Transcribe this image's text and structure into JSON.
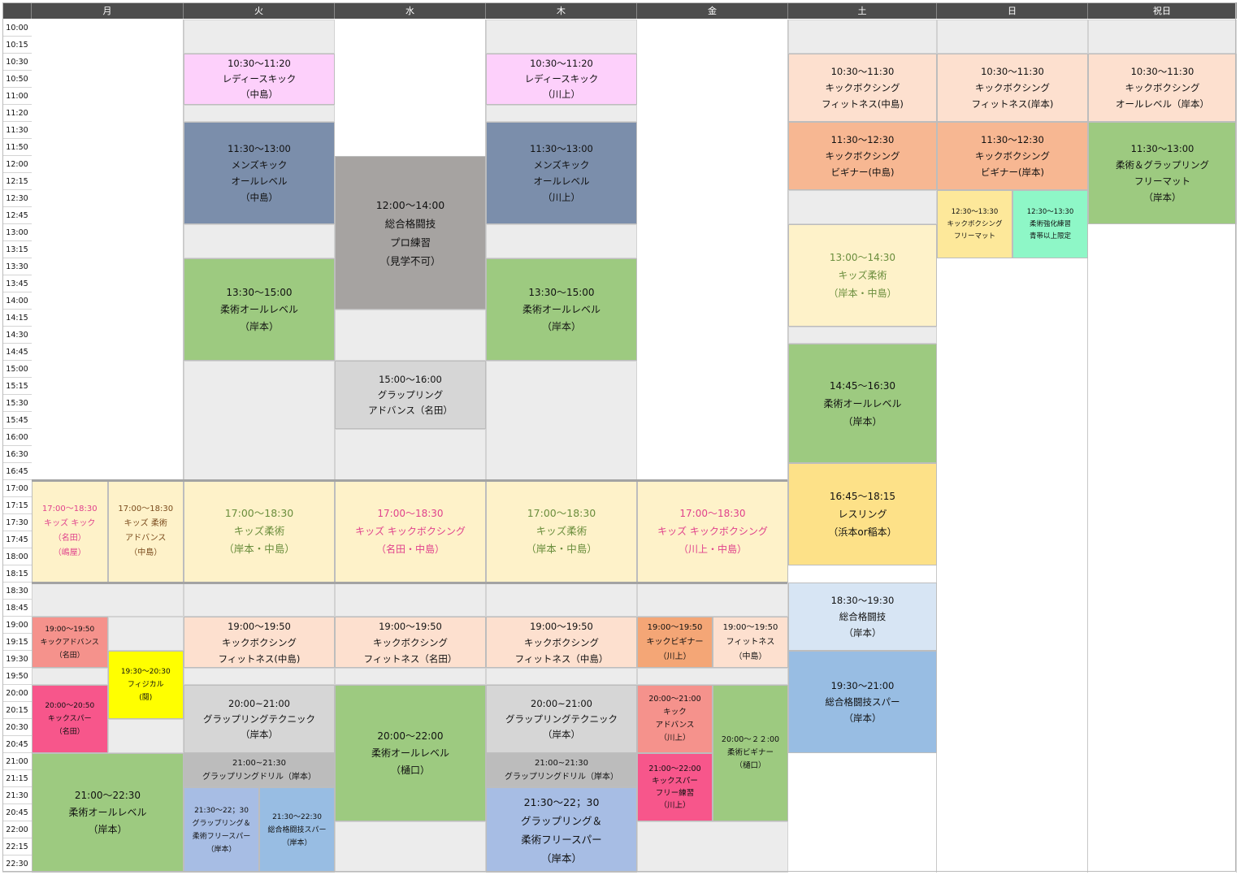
{
  "colors": {
    "gray_blank": "#ececec",
    "pink": "#fdd0fb",
    "slate": "#7b8eab",
    "green": "#9dca80",
    "darkgray": "#a6a3a1",
    "lightgray2": "#d6d6d6",
    "cream": "#fef2c9",
    "peach": "#fde0cf",
    "orange": "#f7b792",
    "yellow_card": "#fde188",
    "pale_blue": "#d7e5f4",
    "blue": "#98bde3",
    "mint": "#8ef7c7",
    "light_yellow": "#fde89a",
    "salmon": "#f5928c",
    "hotpink": "#f7568b",
    "bright_yellow": "#ffff00",
    "gray_mid": "#bcbcbc",
    "periwinkle": "#a7bde4",
    "orange2": "#f4a676"
  },
  "days": [
    "月",
    "火",
    "水",
    "木",
    "金",
    "土",
    "日",
    "祝日"
  ],
  "times": [
    "10:00",
    "10:15",
    "10:30",
    "10:50",
    "11:00",
    "11:20",
    "11:30",
    "11:50",
    "12:00",
    "12:15",
    "12:30",
    "12:45",
    "13:00",
    "13:15",
    "13:30",
    "13:45",
    "14:00",
    "14:15",
    "14:30",
    "14:45",
    "15:00",
    "15:15",
    "15:30",
    "15:45",
    "16:00",
    "16:30",
    "16:45",
    "17:00",
    "17:15",
    "17:30",
    "17:45",
    "18:00",
    "18:15",
    "18:30",
    "18:45",
    "19:00",
    "19:15",
    "19:30",
    "19:50",
    "20:00",
    "20:15",
    "20:30",
    "20:45",
    "21:00",
    "21:15",
    "21:30",
    "20:45",
    "22:00",
    "22:15",
    "22:30"
  ],
  "events": [
    {
      "day": 1,
      "row": 2,
      "span": 3,
      "sub": [
        0,
        1
      ],
      "bg": "pink",
      "fs": 11.5,
      "lh": 19,
      "lines": [
        "10:30〜11:20",
        "レディースキック",
        "（中島）"
      ]
    },
    {
      "day": 3,
      "row": 2,
      "span": 3,
      "sub": [
        0,
        1
      ],
      "bg": "pink",
      "fs": 11.5,
      "lh": 19,
      "lines": [
        "10:30〜11:20",
        "レディースキック",
        "（川上）"
      ]
    },
    {
      "day": 1,
      "row": 6,
      "span": 6,
      "sub": [
        0,
        1
      ],
      "bg": "slate",
      "fs": 11.5,
      "lh": 20,
      "lines": [
        "11:30〜13:00",
        "メンズキック",
        "オールレベル",
        "（中島）"
      ]
    },
    {
      "day": 3,
      "row": 6,
      "span": 6,
      "sub": [
        0,
        1
      ],
      "bg": "slate",
      "fs": 11.5,
      "lh": 20,
      "lines": [
        "11:30〜13:00",
        "メンズキック",
        "オールレベル",
        "（川上）"
      ]
    },
    {
      "day": 2,
      "row": 8,
      "span": 9,
      "sub": [
        0,
        1
      ],
      "bg": "darkgray",
      "fs": 12.5,
      "lh": 23,
      "lines": [
        "12:00〜14:00",
        "総合格闘技",
        "プロ練習",
        "（見学不可）"
      ]
    },
    {
      "day": 1,
      "row": 14,
      "span": 6,
      "sub": [
        0,
        1
      ],
      "bg": "green",
      "fs": 12,
      "lh": 21,
      "lines": [
        "13:30〜15:00",
        "柔術オールレベル",
        "（岸本）"
      ]
    },
    {
      "day": 3,
      "row": 14,
      "span": 6,
      "sub": [
        0,
        1
      ],
      "bg": "green",
      "fs": 12,
      "lh": 21,
      "lines": [
        "13:30〜15:00",
        "柔術オールレベル",
        "（岸本）"
      ]
    },
    {
      "day": 2,
      "row": 20,
      "span": 4,
      "sub": [
        0,
        1
      ],
      "bg": "lightgray2",
      "fs": 11.5,
      "lh": 19,
      "lines": [
        "15:00〜16:00",
        "グラップリング",
        "アドバンス（名田）"
      ]
    },
    {
      "day": 5,
      "row": 2,
      "span": 4,
      "sub": [
        0,
        1
      ],
      "bg": "peach",
      "fs": 11.5,
      "lh": 20,
      "lines": [
        "10:30〜11:30",
        "キックボクシング",
        "フィットネス(中島)"
      ]
    },
    {
      "day": 6,
      "row": 2,
      "span": 4,
      "sub": [
        0,
        1
      ],
      "bg": "peach",
      "fs": 11.5,
      "lh": 20,
      "lines": [
        "10:30〜11:30",
        "キックボクシング",
        "フィットネス(岸本)"
      ]
    },
    {
      "day": 7,
      "row": 2,
      "span": 4,
      "sub": [
        0,
        1
      ],
      "bg": "peach",
      "fs": 11.5,
      "lh": 20,
      "lines": [
        "10:30〜11:30",
        "キックボクシング",
        "オールレベル（岸本）"
      ]
    },
    {
      "day": 5,
      "row": 6,
      "span": 4,
      "sub": [
        0,
        1
      ],
      "bg": "orange",
      "fs": 11.5,
      "lh": 20,
      "lines": [
        "11:30〜12:30",
        "キックボクシング",
        "ビギナー(中島)"
      ]
    },
    {
      "day": 6,
      "row": 6,
      "span": 4,
      "sub": [
        0,
        1
      ],
      "bg": "orange",
      "fs": 11.5,
      "lh": 20,
      "lines": [
        "11:30〜12:30",
        "キックボクシング",
        "ビギナー(岸本)"
      ]
    },
    {
      "day": 7,
      "row": 6,
      "span": 6,
      "sub": [
        0,
        1
      ],
      "bg": "green",
      "fs": 11.5,
      "lh": 20,
      "lines": [
        "11:30〜13:00",
        "柔術＆グラップリング",
        "フリーマット",
        "（岸本）"
      ]
    },
    {
      "day": 6,
      "row": 10,
      "span": 4,
      "sub": [
        0,
        0.5
      ],
      "bg": "light_yellow",
      "fs": 8.5,
      "lh": 15,
      "lines": [
        "12:30〜13:30",
        "キックボクシング",
        "フリーマット"
      ]
    },
    {
      "day": 6,
      "row": 10,
      "span": 4,
      "sub": [
        0.5,
        1
      ],
      "bg": "mint",
      "fs": 8.5,
      "lh": 15,
      "lines": [
        "12:30〜13:30",
        "柔術強化練習",
        "青帯以上限定"
      ]
    },
    {
      "day": 5,
      "row": 12,
      "span": 6,
      "sub": [
        0,
        1
      ],
      "bg": "cream",
      "fs": 12,
      "lh": 22,
      "color": "#6a8d3c",
      "lines": [
        "13:00〜14:30",
        "キッズ柔術",
        "（岸本・中島）"
      ]
    },
    {
      "day": 5,
      "row": 19,
      "span": 7,
      "sub": [
        0,
        1
      ],
      "bg": "green",
      "fs": 12,
      "lh": 22,
      "lines": [
        "14:45〜16:30",
        "柔術オールレベル",
        "（岸本）"
      ]
    },
    {
      "day": 5,
      "row": 26,
      "span": 6,
      "sub": [
        0,
        1
      ],
      "bg": "yellow_card",
      "fs": 12,
      "lh": 22,
      "lines": [
        "16:45〜18:15",
        "レスリング",
        "（浜本or稲本）"
      ]
    },
    {
      "day": 0,
      "row": 27,
      "span": 6,
      "sub": [
        0,
        0.5
      ],
      "bg": "cream",
      "fs": 10,
      "lh": 18,
      "color": "#e0418c",
      "lines": [
        "17:00〜18:30",
        "キッズ キック",
        "（名田）",
        "（嶋屋）"
      ]
    },
    {
      "day": 0,
      "row": 27,
      "span": 6,
      "sub": [
        0.5,
        1
      ],
      "bg": "cream",
      "fs": 10,
      "lh": 18,
      "color": "#7a4a1c",
      "lines": [
        "17:00〜18:30",
        "キッズ 柔術",
        "アドバンス",
        "（中島）"
      ]
    },
    {
      "day": 1,
      "row": 27,
      "span": 6,
      "sub": [
        0,
        1
      ],
      "bg": "cream",
      "fs": 12.5,
      "lh": 22,
      "color": "#6a8d3c",
      "lines": [
        "17:00〜18:30",
        "キッズ柔術",
        "（岸本・中島）"
      ]
    },
    {
      "day": 2,
      "row": 27,
      "span": 6,
      "sub": [
        0,
        1
      ],
      "bg": "cream",
      "fs": 12,
      "lh": 22,
      "color": "#e0418c",
      "lines": [
        "17:00〜18:30",
        "キッズ キックボクシング",
        "（名田・中島）"
      ]
    },
    {
      "day": 3,
      "row": 27,
      "span": 6,
      "sub": [
        0,
        1
      ],
      "bg": "cream",
      "fs": 12.5,
      "lh": 22,
      "color": "#6a8d3c",
      "lines": [
        "17:00〜18:30",
        "キッズ柔術",
        "（岸本・中島）"
      ]
    },
    {
      "day": 4,
      "row": 27,
      "span": 6,
      "sub": [
        0,
        1
      ],
      "bg": "cream",
      "fs": 12,
      "lh": 22,
      "color": "#e0418c",
      "lines": [
        "17:00〜18:30",
        "キッズ キックボクシング",
        "（川上・中島）"
      ]
    },
    {
      "day": 5,
      "row": 33,
      "span": 4,
      "sub": [
        0,
        1
      ],
      "bg": "pale_blue",
      "fs": 11.5,
      "lh": 20,
      "lines": [
        "18:30〜19:30",
        "総合格闘技",
        "（岸本）"
      ]
    },
    {
      "day": 5,
      "row": 37,
      "span": 6,
      "sub": [
        0,
        1
      ],
      "bg": "blue",
      "fs": 11.5,
      "lh": 20,
      "lines": [
        "19:30〜21:00",
        "総合格闘技スパー",
        "（岸本）"
      ]
    },
    {
      "day": 0,
      "row": 35,
      "span": 3,
      "sub": [
        0,
        0.5
      ],
      "bg": "salmon",
      "fs": 9,
      "lh": 16,
      "lines": [
        "19:00〜19:50",
        "キックアドバンス",
        "（名田）"
      ]
    },
    {
      "day": 0,
      "row": 37,
      "span": 4,
      "sub": [
        0.5,
        1
      ],
      "bg": "bright_yellow",
      "fs": 9,
      "lh": 16,
      "lines": [
        "19:30〜20:30",
        "フィジカル",
        "(鬩)"
      ]
    },
    {
      "day": 0,
      "row": 39,
      "span": 4,
      "sub": [
        0,
        0.5
      ],
      "bg": "hotpink",
      "fs": 9,
      "lh": 16,
      "lines": [
        "20:00〜20:50",
        "キックスパー",
        "（名田）"
      ]
    },
    {
      "day": 0,
      "row": 43,
      "span": 7,
      "sub": [
        0,
        1
      ],
      "bg": "green",
      "fs": 12,
      "lh": 21,
      "lines": [
        "21:00〜22:30",
        "柔術オールレベル",
        "（岸本）"
      ]
    },
    {
      "day": 1,
      "row": 35,
      "span": 3,
      "sub": [
        0,
        1
      ],
      "bg": "peach",
      "fs": 11.5,
      "lh": 20,
      "lines": [
        "19:00〜19:50",
        "キックボクシング",
        "フィットネス(中島)"
      ]
    },
    {
      "day": 2,
      "row": 35,
      "span": 3,
      "sub": [
        0,
        1
      ],
      "bg": "peach",
      "fs": 11.5,
      "lh": 20,
      "lines": [
        "19:00〜19:50",
        "キックボクシング",
        "フィットネス（名田）"
      ]
    },
    {
      "day": 3,
      "row": 35,
      "span": 3,
      "sub": [
        0,
        1
      ],
      "bg": "peach",
      "fs": 11.5,
      "lh": 20,
      "lines": [
        "19:00〜19:50",
        "キックボクシング",
        "フィットネス（中島）"
      ]
    },
    {
      "day": 4,
      "row": 35,
      "span": 3,
      "sub": [
        0,
        0.5
      ],
      "bg": "orange2",
      "fs": 10,
      "lh": 18,
      "lines": [
        "19:00〜19:50",
        "キックビギナー",
        "（川上）"
      ]
    },
    {
      "day": 4,
      "row": 35,
      "span": 3,
      "sub": [
        0.5,
        1
      ],
      "bg": "peach",
      "fs": 10,
      "lh": 18,
      "lines": [
        "19:00〜19:50",
        "フィットネス",
        "（中島）"
      ]
    },
    {
      "day": 1,
      "row": 39,
      "span": 4,
      "sub": [
        0,
        1
      ],
      "bg": "lightgray2",
      "fs": 11.5,
      "lh": 19,
      "lines": [
        "20:00~21:00",
        "グラップリングテクニック",
        "（岸本）"
      ]
    },
    {
      "day": 3,
      "row": 39,
      "span": 4,
      "sub": [
        0,
        1
      ],
      "bg": "lightgray2",
      "fs": 11.5,
      "lh": 19,
      "lines": [
        "20:00~21:00",
        "グラップリングテクニック",
        "（岸本）"
      ]
    },
    {
      "day": 2,
      "row": 39,
      "span": 8,
      "sub": [
        0,
        1
      ],
      "bg": "green",
      "fs": 12,
      "lh": 21,
      "lines": [
        "20:00〜22:00",
        "柔術オールレベル",
        "（樋口）"
      ]
    },
    {
      "day": 4,
      "row": 39,
      "span": 4,
      "sub": [
        0,
        0.5
      ],
      "bg": "salmon",
      "fs": 9.5,
      "lh": 16,
      "lines": [
        "20:00〜21:00",
        "キック",
        "アドバンス",
        "（川上）"
      ]
    },
    {
      "day": 4,
      "row": 39,
      "span": 8,
      "sub": [
        0.5,
        1
      ],
      "bg": "green",
      "fs": 9.5,
      "lh": 16,
      "lines": [
        "20:00〜２２:00",
        "柔術ビギナー",
        "（樋口）"
      ]
    },
    {
      "day": 4,
      "row": 43,
      "span": 4,
      "sub": [
        0,
        0.5
      ],
      "bg": "hotpink",
      "fs": 9.5,
      "lh": 15,
      "lines": [
        "21:00〜22:00",
        "キックスパー",
        "フリー練習",
        "（川上）"
      ]
    },
    {
      "day": 1,
      "row": 43,
      "span": 2,
      "sub": [
        0,
        1
      ],
      "bg": "gray_mid",
      "fs": 10,
      "lh": 17,
      "lines": [
        "21:00~21:30",
        "グラップリングドリル（岸本）"
      ]
    },
    {
      "day": 3,
      "row": 43,
      "span": 2,
      "sub": [
        0,
        1
      ],
      "bg": "gray_mid",
      "fs": 10,
      "lh": 17,
      "lines": [
        "21:00~21:30",
        "グラップリングドリル（岸本）"
      ]
    },
    {
      "day": 1,
      "row": 45,
      "span": 5,
      "sub": [
        0,
        0.5
      ],
      "bg": "periwinkle",
      "fs": 9,
      "lh": 16,
      "lines": [
        "21:30〜22；30",
        "グラップリング＆",
        "柔術フリースパー",
        "（岸本）"
      ]
    },
    {
      "day": 1,
      "row": 45,
      "span": 5,
      "sub": [
        0.5,
        1
      ],
      "bg": "blue",
      "fs": 9,
      "lh": 16,
      "lines": [
        "21:30〜22:30",
        "総合格闘技スパー",
        "（岸本）"
      ]
    },
    {
      "day": 3,
      "row": 45,
      "span": 5,
      "sub": [
        0,
        1
      ],
      "bg": "periwinkle",
      "fs": 12.5,
      "lh": 23,
      "lines": [
        "21:30〜22；30",
        "グラップリング＆",
        "柔術フリースパー",
        "（岸本）"
      ]
    }
  ],
  "blanks": [
    {
      "day": 1,
      "row": 0,
      "span": 2
    },
    {
      "day": 1,
      "row": 5,
      "span": 1
    },
    {
      "day": 1,
      "row": 12,
      "span": 2
    },
    {
      "day": 3,
      "row": 0,
      "span": 2
    },
    {
      "day": 3,
      "row": 5,
      "span": 1
    },
    {
      "day": 3,
      "row": 12,
      "span": 2
    },
    {
      "day": 2,
      "row": 17,
      "span": 3
    },
    {
      "day": 2,
      "row": 24,
      "span": 3
    },
    {
      "day": 1,
      "row": 20,
      "span": 7
    },
    {
      "day": 3,
      "row": 20,
      "span": 7
    },
    {
      "day": 5,
      "row": 0,
      "span": 2
    },
    {
      "day": 6,
      "row": 0,
      "span": 2
    },
    {
      "day": 7,
      "row": 0,
      "span": 2
    },
    {
      "day": 5,
      "row": 10,
      "span": 2
    },
    {
      "day": 5,
      "row": 18,
      "span": 1
    },
    {
      "day": 1,
      "row": 33,
      "span": 2
    },
    {
      "day": 2,
      "row": 33,
      "span": 2
    },
    {
      "day": 3,
      "row": 33,
      "span": 2
    },
    {
      "day": 4,
      "row": 33,
      "span": 2
    },
    {
      "day": 0,
      "row": 33,
      "span": 2
    },
    {
      "day": 0,
      "row": 35,
      "span": 2,
      "half": 1
    },
    {
      "day": 0,
      "row": 38,
      "span": 1,
      "half": 0
    },
    {
      "day": 0,
      "row": 41,
      "span": 2,
      "half": 1
    },
    {
      "day": 1,
      "row": 38,
      "span": 1
    },
    {
      "day": 2,
      "row": 38,
      "span": 1
    },
    {
      "day": 3,
      "row": 38,
      "span": 1
    },
    {
      "day": 4,
      "row": 38,
      "span": 1
    },
    {
      "day": 2,
      "row": 47,
      "span": 3
    },
    {
      "day": 4,
      "row": 47,
      "span": 3
    }
  ]
}
